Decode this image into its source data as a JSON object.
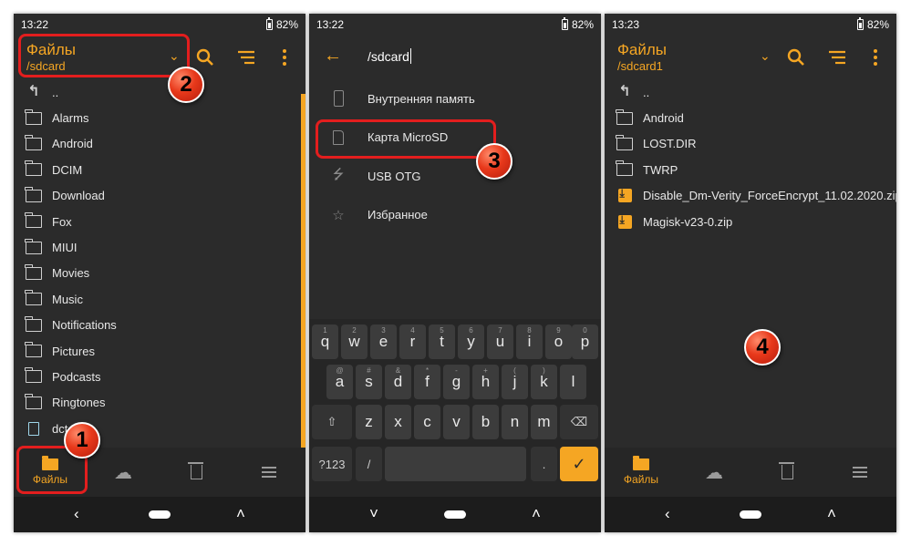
{
  "status": {
    "battery": "82%"
  },
  "screen1": {
    "time": "13:22",
    "title": "Файлы",
    "path": "/sdcard",
    "items": [
      "..",
      "Alarms",
      "Android",
      "DCIM",
      "Download",
      "Fox",
      "MIUI",
      "Movies",
      "Music",
      "Notifications",
      "Pictures",
      "Podcasts",
      "Ringtones",
      "dct"
    ],
    "nav": {
      "files": "Файлы"
    }
  },
  "screen2": {
    "time": "13:22",
    "path_value": "/sdcard",
    "storage": [
      "Внутренняя память",
      "Карта MicroSD",
      "USB OTG",
      "Избранное"
    ],
    "keyboard": {
      "row1": [
        "q",
        "w",
        "e",
        "r",
        "t",
        "y",
        "u",
        "i",
        "o",
        "p"
      ],
      "row1_hints": [
        "1",
        "2",
        "3",
        "4",
        "5",
        "6",
        "7",
        "8",
        "9",
        "0"
      ],
      "row2": [
        "a",
        "s",
        "d",
        "f",
        "g",
        "h",
        "j",
        "k",
        "l"
      ],
      "row2_hints": [
        "@",
        "#",
        "&",
        "*",
        "-",
        "+",
        "(",
        ")",
        ""
      ],
      "row3": [
        "z",
        "x",
        "c",
        "v",
        "b",
        "n",
        "m"
      ],
      "sym": "?123",
      "slash": "/",
      "dot": "."
    }
  },
  "screen3": {
    "time": "13:23",
    "title": "Файлы",
    "path": "/sdcard1",
    "items": [
      "..",
      "Android",
      "LOST.DIR",
      "TWRP",
      "Disable_Dm-Verity_ForceEncrypt_11.02.2020.zip",
      "Magisk-v23-0.zip"
    ],
    "nav": {
      "files": "Файлы"
    }
  },
  "markers": {
    "m1": "1",
    "m2": "2",
    "m3": "3",
    "m4": "4"
  },
  "colors": {
    "accent": "#f5a623",
    "highlight": "#e31e1e",
    "background": "#2b2b2b"
  }
}
